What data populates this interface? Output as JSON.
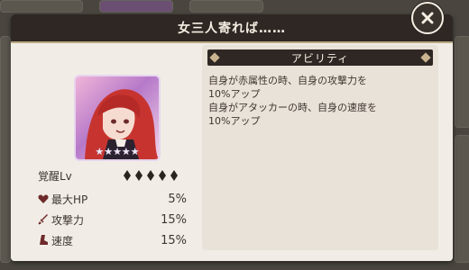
{
  "dialog": {
    "title": "女三人寄れば……"
  },
  "card": {
    "rarity_stars": "★★★★★"
  },
  "stats": {
    "awaken_label": "覚醒Lv",
    "awaken_level": 5,
    "rows": [
      {
        "label": "最大HP",
        "value": "5%",
        "icon": "heart-icon"
      },
      {
        "label": "攻撃力",
        "value": "15%",
        "icon": "sword-icon"
      },
      {
        "label": "速度",
        "value": "15%",
        "icon": "boot-icon"
      }
    ]
  },
  "ability": {
    "title": "アビリティ",
    "text": "自身が赤属性の時、自身の攻撃力を\n10%アップ\n自身がアタッカーの時、自身の速度を\n10%アップ"
  },
  "colors": {
    "title_bar": "#2e2723",
    "panel": "#f1ede6",
    "accent": "#b9a982"
  }
}
